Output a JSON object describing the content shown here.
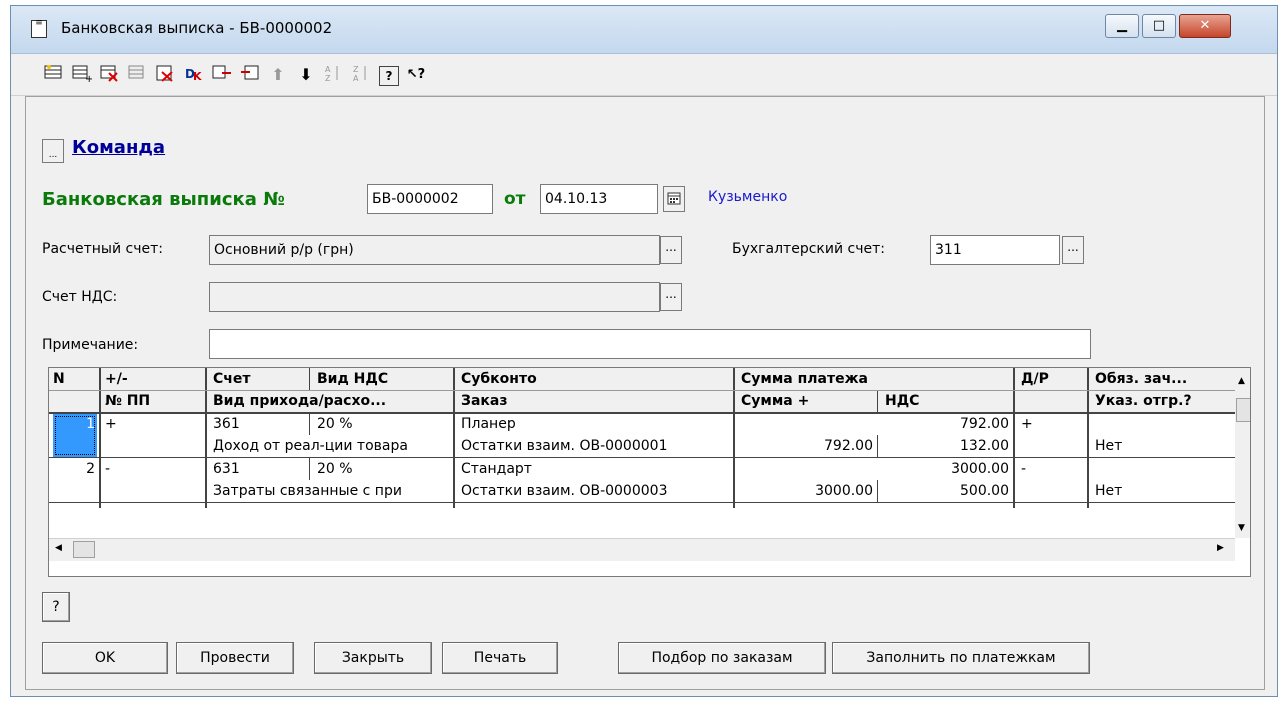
{
  "window": {
    "title": "Банковская выписка - БВ-0000002",
    "minimize_glyph": "▁",
    "maximize_glyph": "□",
    "close_glyph": "✕"
  },
  "toolbar": {
    "icons": [
      "new-row-icon",
      "copy-row-icon",
      "delete-row-icon",
      "edit-row-icon",
      "delete-icon",
      "dk-icon",
      "move-icon",
      "insert-icon",
      "up-arrow-icon",
      "down-arrow-icon",
      "sort-asc-icon",
      "sort-desc-icon",
      "help-icon",
      "whats-this-icon"
    ],
    "up_glyph": "⬆",
    "down_glyph": "⬇",
    "help_glyph": "?",
    "whatsthis_glyph": "↖?"
  },
  "form": {
    "command_label": "Команда",
    "heading": "Банковская выписка №",
    "doc_number": "БВ-0000002",
    "from_label": "от",
    "date": "04.10.13",
    "author": "Кузьменко",
    "account_label": "Расчетный счет:",
    "account_value": "Основний р/р (грн)",
    "acc_account_label": "Бухгалтерский счет:",
    "acc_account_value": "311",
    "vat_account_label": "Счет НДС:",
    "vat_account_value": "",
    "note_label": "Примечание:",
    "note_value": "",
    "ellipsis": "..."
  },
  "table": {
    "headers_row1": [
      "N",
      "+/-",
      "Счет",
      "Вид НДС",
      "Субконто",
      "Сумма платежа",
      "Д/Р",
      "Обяз. зач..."
    ],
    "headers_row2": [
      "",
      "№ ПП",
      "Вид прихода/расхо...",
      "Заказ",
      "Сумма +",
      "НДС",
      "",
      "Указ. отгр.?"
    ],
    "rows": [
      {
        "n": "1",
        "sign": "+",
        "account": "361",
        "vat_type": "20 %",
        "subconto": "Планер",
        "amount": "792.00",
        "dr": "+",
        "obyaz": "",
        "pp": "",
        "kind": "Доход от реал-ции товара",
        "order": "Остатки взаим. ОВ-0000001",
        "sum_plus": "792.00",
        "vat": "132.00",
        "ukaz": "Нет"
      },
      {
        "n": "2",
        "sign": "-",
        "account": "631",
        "vat_type": "20 %",
        "subconto": "Стандарт",
        "amount": "3000.00",
        "dr": "-",
        "obyaz": "",
        "pp": "",
        "kind": "Затраты связанные с при",
        "order": "Остатки взаим. ОВ-0000003",
        "sum_plus": "3000.00",
        "vat": "500.00",
        "ukaz": "Нет"
      }
    ]
  },
  "buttons": {
    "help": "?",
    "ok": "OK",
    "post": "Провести",
    "close": "Закрыть",
    "print": "Печать",
    "select_orders": "Подбор по заказам",
    "fill_payments": "Заполнить по платежкам"
  },
  "colors": {
    "heading_green": "#0a7a0a",
    "link_blue": "#000099",
    "author_blue": "#1a1acc",
    "selection_blue": "#3399ff"
  }
}
